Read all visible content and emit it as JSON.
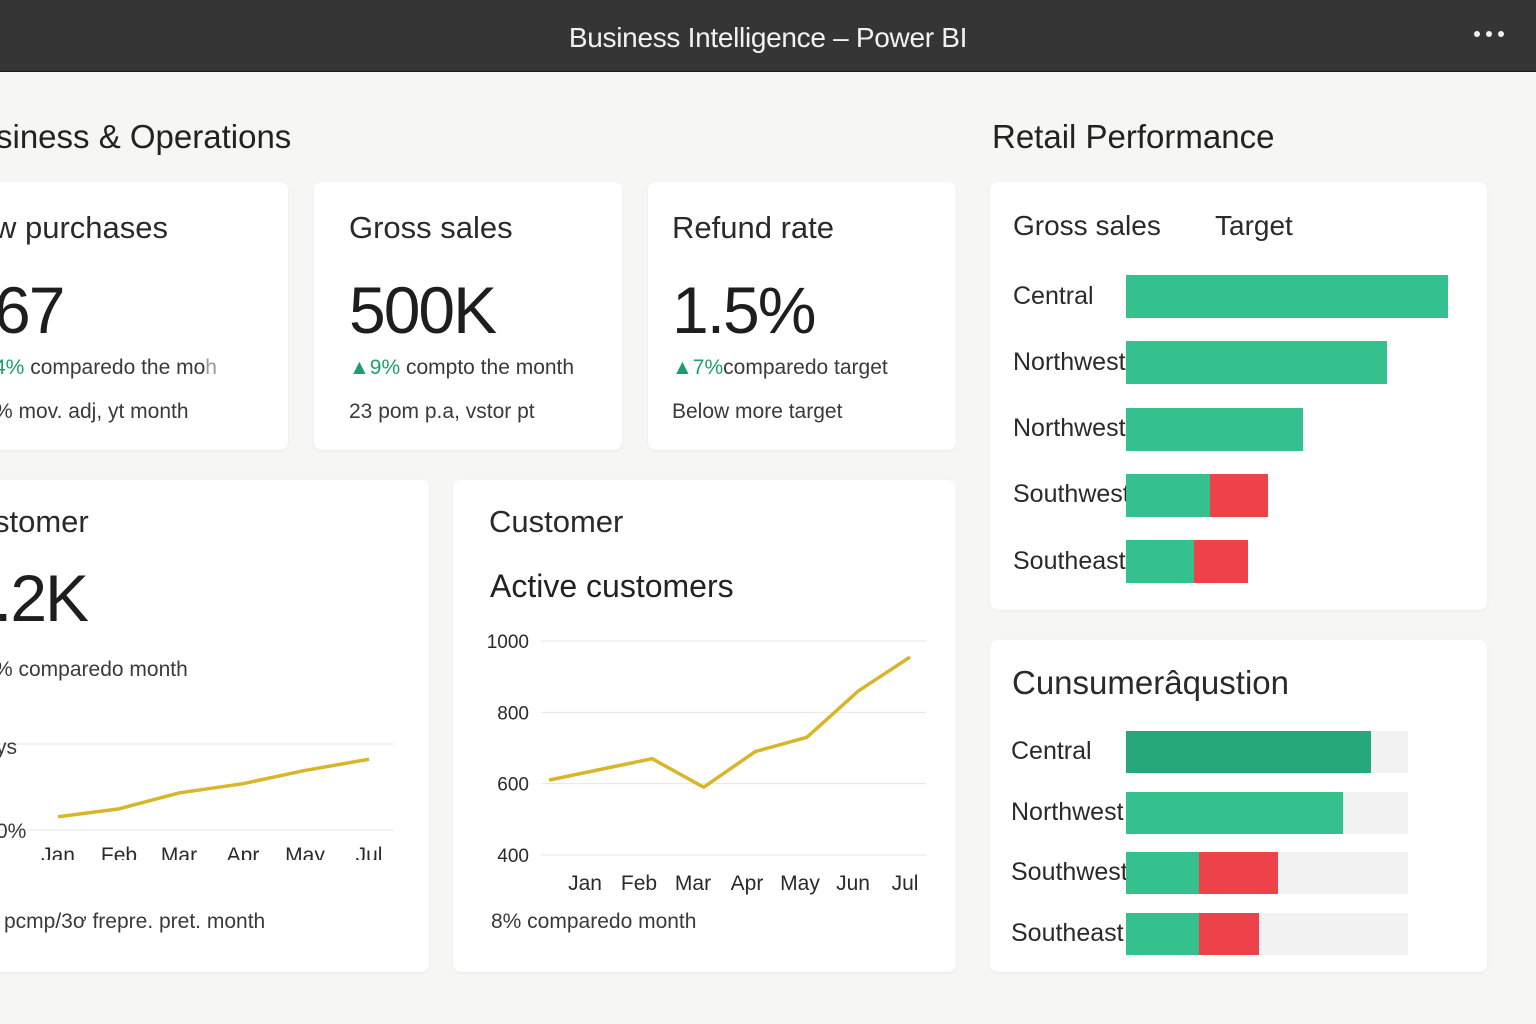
{
  "window": {
    "title": "Business Intelligence – Power BI"
  },
  "sections": {
    "left_title": "siness & Operations",
    "right_title": "Retail Performance"
  },
  "kpis": [
    {
      "title": "w purchases",
      "value": "67",
      "delta_pct": "4%",
      "delta_text": " comparedo the mo",
      "delta_suffix": "h",
      "note": "% mov. adj, yt  month"
    },
    {
      "title": "Gross sales",
      "value": "500K",
      "delta_pct": "▲9%",
      "delta_text": " compto the month",
      "delta_suffix": "",
      "note": "23 pom p.a, vstor pt"
    },
    {
      "title": "Refund rate",
      "value": "1.5%",
      "delta_pct": "▲7%",
      "delta_text": "comparedo target",
      "delta_suffix": "",
      "note": "Below more target"
    }
  ],
  "customer_card": {
    "title": "stomer",
    "value": ".2K",
    "delta": "% comparedo month",
    "y_tick_upper": "ys",
    "y_tick_lower": "0%",
    "footer": "pcmp/3ơ  frepre. pret. month",
    "chart_data": {
      "type": "line",
      "categories": [
        "Jan",
        "Feb",
        "Mar",
        "Apr",
        "May",
        "Jul"
      ],
      "series": [
        {
          "values": [
            20,
            32,
            56,
            70,
            90,
            107
          ]
        }
      ],
      "ylim": [
        0,
        130
      ],
      "color": "#d9b52a"
    }
  },
  "active_card": {
    "title": "Customer",
    "subtitle": "Active customers",
    "footer": "8% comparedo month",
    "chart_data": {
      "type": "line",
      "categories": [
        "Jan",
        "Feb",
        "Mar",
        "Apr",
        "May",
        "Jun",
        "Jul"
      ],
      "series": [
        {
          "values": [
            610,
            640,
            670,
            590,
            690,
            730,
            860,
            955
          ]
        }
      ],
      "yticks": [
        1000,
        800,
        600,
        400
      ],
      "ylim": [
        400,
        1000
      ],
      "color": "#d9b52a",
      "grid": true
    }
  },
  "retail_card": {
    "legend": [
      "Gross sales",
      "Target"
    ],
    "chart_data": {
      "type": "bar",
      "orientation": "horizontal",
      "categories": [
        "Central",
        "Northwest",
        "Northwest",
        "Southwest",
        "Southeast"
      ],
      "series": [
        {
          "color": "#34c18e",
          "values": [
            100,
            81,
            55,
            26,
            21
          ]
        },
        {
          "color": "#ed4249",
          "values": [
            0,
            0,
            0,
            18,
            17
          ]
        }
      ],
      "xlim": [
        0,
        100
      ]
    }
  },
  "consumer_card": {
    "title": "Cunsumerâqustion",
    "chart_data": {
      "type": "bar",
      "orientation": "horizontal",
      "categories": [
        "Central",
        "Northwest",
        "Southwest",
        "Southeast"
      ],
      "series": [
        {
          "colors": [
            "#27a87a",
            "#34c18e",
            "#34c18e",
            "#34c18e"
          ],
          "values": [
            87,
            77,
            26,
            26
          ]
        },
        {
          "color": "#ed4249",
          "values": [
            0,
            0,
            28,
            21
          ]
        }
      ],
      "xlim": [
        0,
        100
      ],
      "track_color": "#f2f2f2"
    }
  }
}
